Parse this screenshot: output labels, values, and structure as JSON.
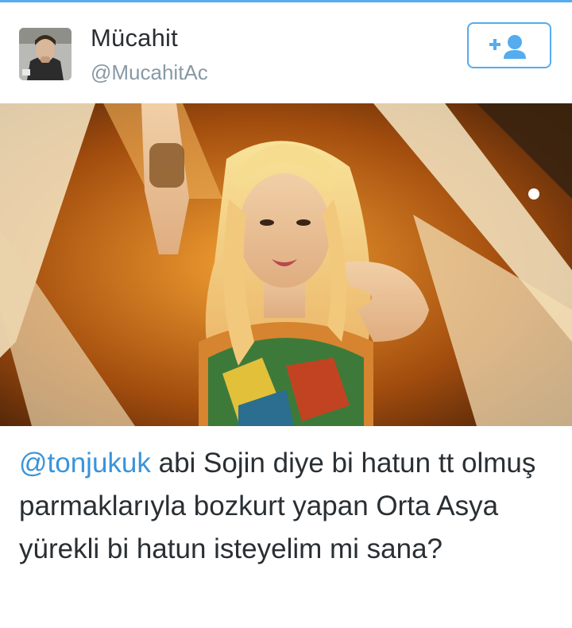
{
  "user": {
    "display_name": "Mücahit",
    "screen_name": "@MucahitAc"
  },
  "follow_button": {
    "icon": "follow-user-plus-icon",
    "color": "#55acee"
  },
  "media": {
    "type": "photo"
  },
  "tweet": {
    "mention": "@tonjukuk",
    "text": " abi Sojin diye bi hatun tt olmuş parmaklarıyla bozkurt yapan Orta Asya yürekli bi hatun isteyelim mi sana?"
  },
  "colors": {
    "accent": "#55acee",
    "mention": "#3b94d9",
    "text": "#292f33",
    "secondary": "#8899a6"
  }
}
